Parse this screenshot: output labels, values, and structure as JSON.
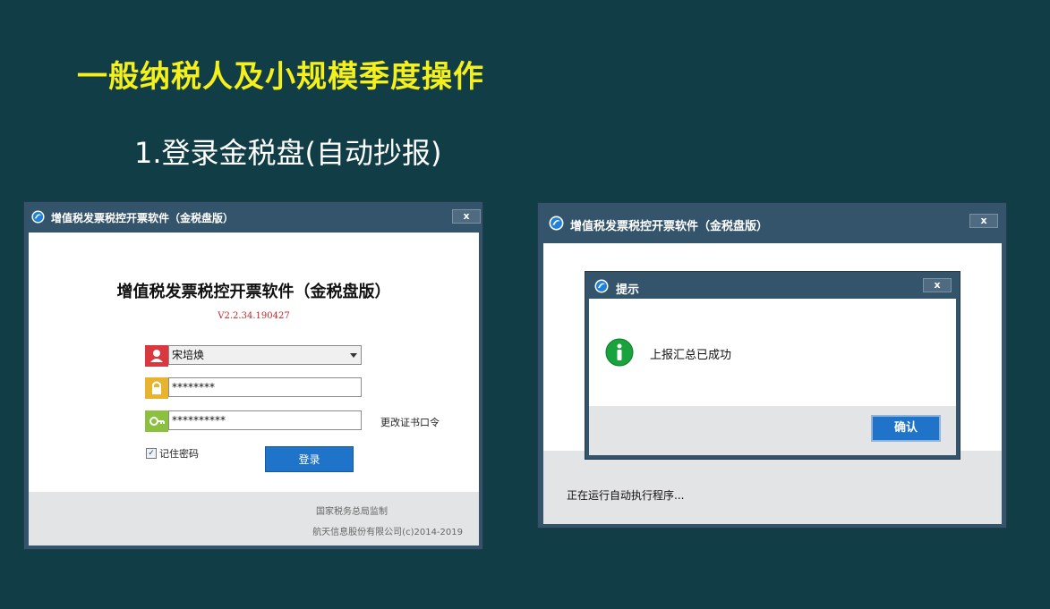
{
  "slide": {
    "title": "一般纳税人及小规模季度操作",
    "subtitle": "1.登录金税盘(自动抄报)"
  },
  "login_window": {
    "title": "增值税发票税控开票软件（金税盘版）",
    "close_label": "x",
    "heading": "增值税发票税控开票软件（金税盘版）",
    "version": "V2.2.34.190427",
    "user_select_value": "宋培焕",
    "password_value": "********",
    "cert_password_value": "**********",
    "change_cert_link": "更改证书口令",
    "remember_label": "记住密码",
    "remember_checked": true,
    "login_button": "登录",
    "footer_line1": "国家税务总局监制",
    "footer_line2": "航天信息股份有限公司(c)2014-2019"
  },
  "status_window": {
    "title": "增值税发票税控开票软件（金税盘版）",
    "close_label": "x",
    "status_text": "正在运行自动执行程序..."
  },
  "dialog": {
    "title": "提示",
    "close_label": "x",
    "message": "上报汇总已成功",
    "ok_button": "确认"
  },
  "colors": {
    "background": "#113d46",
    "title_yellow": "#f5ef1a",
    "window_frame": "#34546c",
    "button_blue": "#1f73c9",
    "user_icon_bg": "#d9393e",
    "lock_icon_bg": "#e8b430",
    "key_icon_bg": "#8cc13f",
    "info_icon_bg": "#19a33d"
  },
  "icons": [
    "app-logo-icon",
    "user-icon",
    "lock-icon",
    "key-icon",
    "info-icon",
    "close-icon",
    "chevron-down-icon",
    "checkmark-icon"
  ]
}
